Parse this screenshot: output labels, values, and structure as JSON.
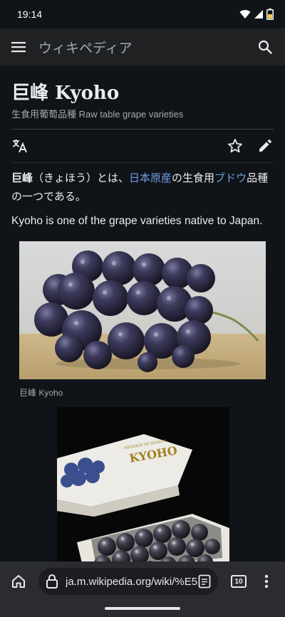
{
  "status": {
    "time": "19:14"
  },
  "header": {
    "site_title": "ウィキペディア"
  },
  "article": {
    "title": "巨峰 Kyoho",
    "subtitle": "生食用葡萄品種 Raw table grape varieties",
    "para1": {
      "bold": "巨峰",
      "t1": "（きょほう）とは、",
      "link1": "日本原産",
      "t2": "の生食用",
      "link2": "ブドウ",
      "t3": "品種の一つである。"
    },
    "para2": "Kyoho is one of the grape varieties native to Japan.",
    "figure1_caption": "巨峰 Kyoho",
    "box_label": "KYOHO",
    "box_small_label": "MESSAGE OF SEASON"
  },
  "browser": {
    "url": "ja.m.wikipedia.org/wiki/%E5",
    "tab_count": "10"
  },
  "colors": {
    "link": "#6d9fe6",
    "background": "#101418",
    "header": "#202122"
  },
  "icons": [
    "menu-icon",
    "search-icon",
    "translate-icon",
    "star-icon",
    "edit-pencil-icon",
    "home-icon",
    "lock-icon",
    "reader-icon",
    "tabs-icon",
    "more-vert-icon"
  ]
}
